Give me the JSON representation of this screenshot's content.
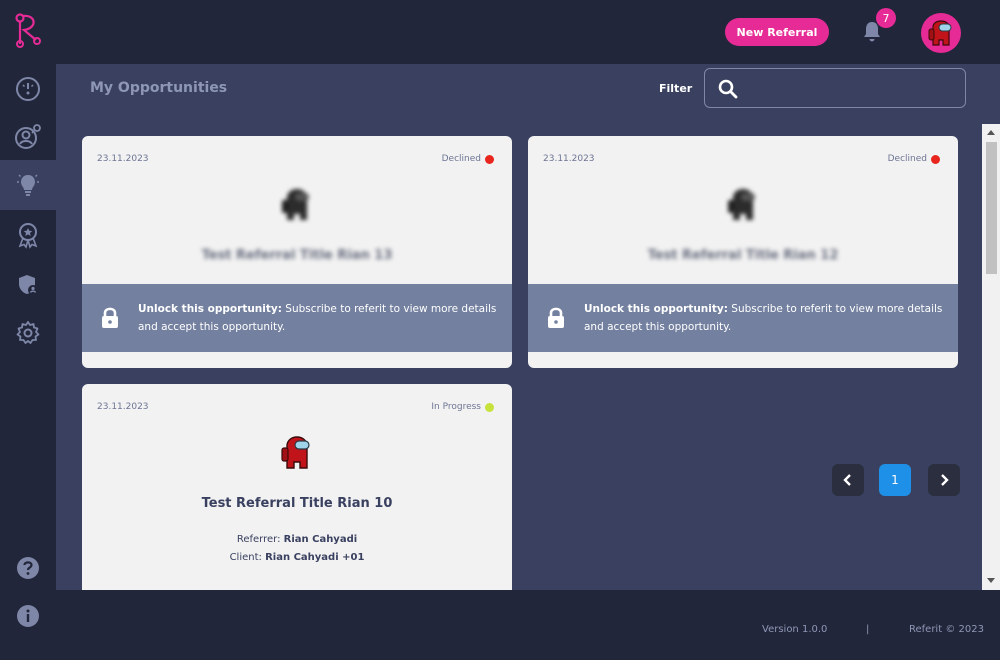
{
  "topbar": {
    "new_referral_label": "New Referral",
    "notification_count": "7"
  },
  "header": {
    "title": "My Opportunities",
    "filter_label": "Filter",
    "filter_value": ""
  },
  "cards": [
    {
      "date": "23.11.2023",
      "status": "Declined",
      "status_color": "#e8261e",
      "title": "Test Referral Title Rian 13",
      "unlock_bold": "Unlock this opportunity:",
      "unlock_text": " Subscribe to referit to view more details and accept this opportunity."
    },
    {
      "date": "23.11.2023",
      "status": "Declined",
      "status_color": "#e8261e",
      "title": "Test Referral Title Rian 12",
      "unlock_bold": "Unlock this opportunity:",
      "unlock_text": " Subscribe to referit to view more details and accept this opportunity."
    },
    {
      "date": "23.11.2023",
      "status": "In Progress",
      "status_color": "#c7e23a",
      "title": "Test Referral Title Rian 10",
      "referrer_label": "Referrer:",
      "referrer": "Rian Cahyadi",
      "client_label": "Client:",
      "client": "Rian Cahyadi +01"
    }
  ],
  "pagination": {
    "current_page": "1"
  },
  "footer": {
    "version": "Version 1.0.0",
    "separator": "|",
    "copyright": "Referit © 2023"
  },
  "colors": {
    "accent": "#e62b97",
    "background": "#22263a",
    "panel": "#3a4160",
    "active_page": "#1e90e8"
  },
  "icons": [
    "logo-icon",
    "bell-icon",
    "dashboard-icon",
    "user-referral-icon",
    "lightbulb-icon",
    "award-icon",
    "shield-user-icon",
    "gear-icon",
    "help-icon",
    "info-icon",
    "search-icon",
    "lock-icon",
    "chevron-left-icon",
    "chevron-right-icon"
  ]
}
